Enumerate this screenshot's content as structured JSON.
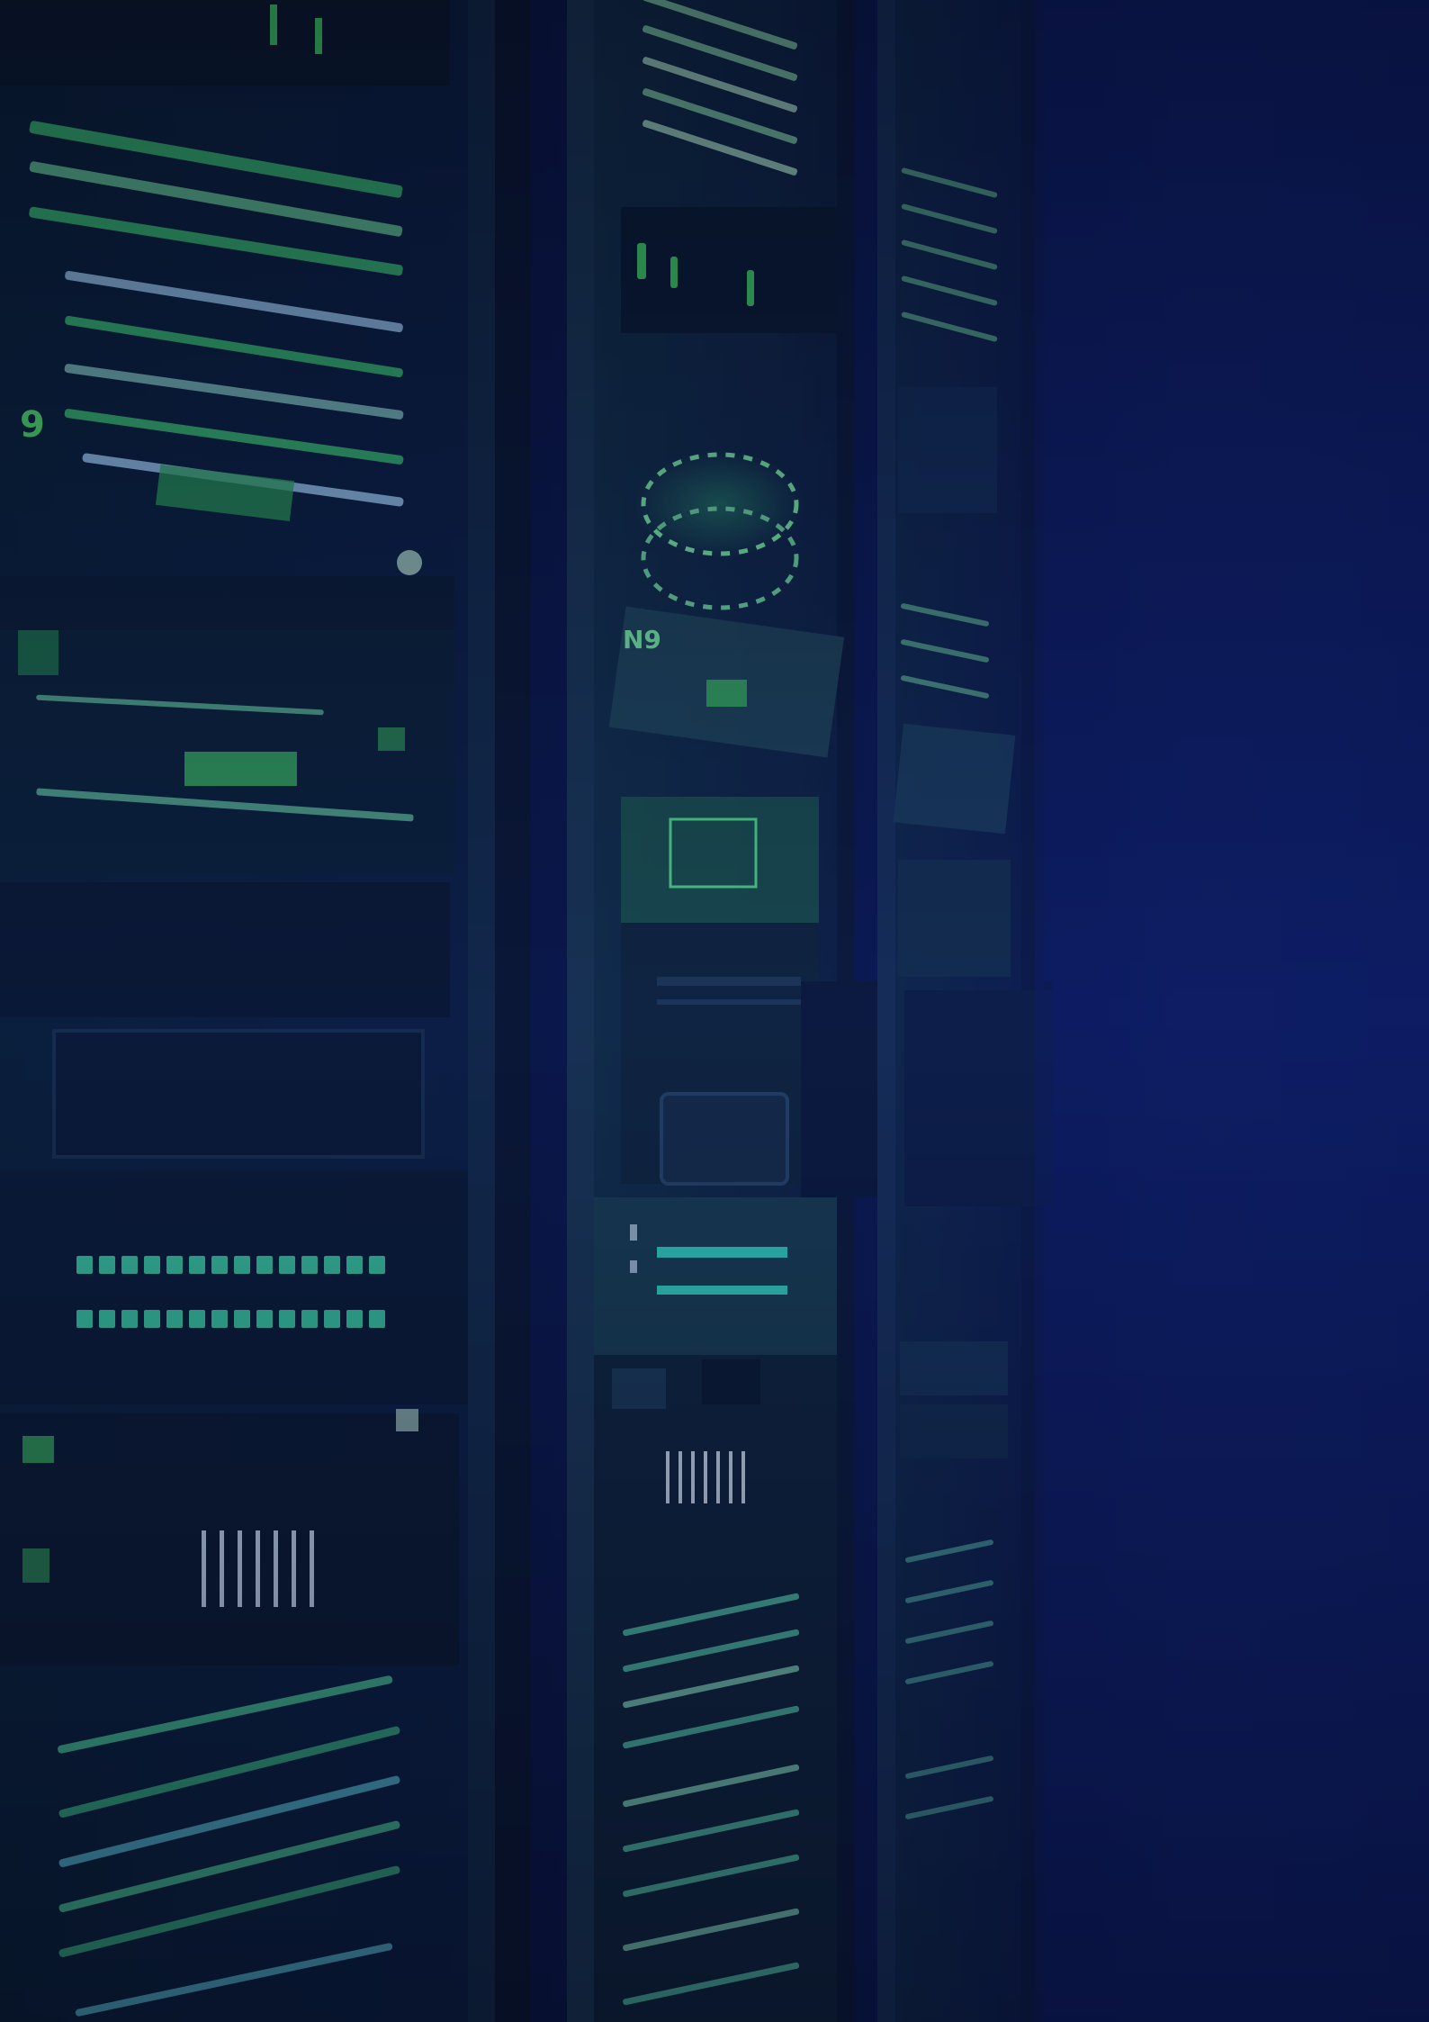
{
  "scene": {
    "subject": "server-racks",
    "palette": {
      "background_deep": "#08103a",
      "background_right": "#10206a",
      "rack_frame": "#142447",
      "rack_shadow": "#050c26",
      "led_green": "#44d86a",
      "led_teal": "#2fd8c0",
      "led_white": "#cfe6ff"
    }
  }
}
